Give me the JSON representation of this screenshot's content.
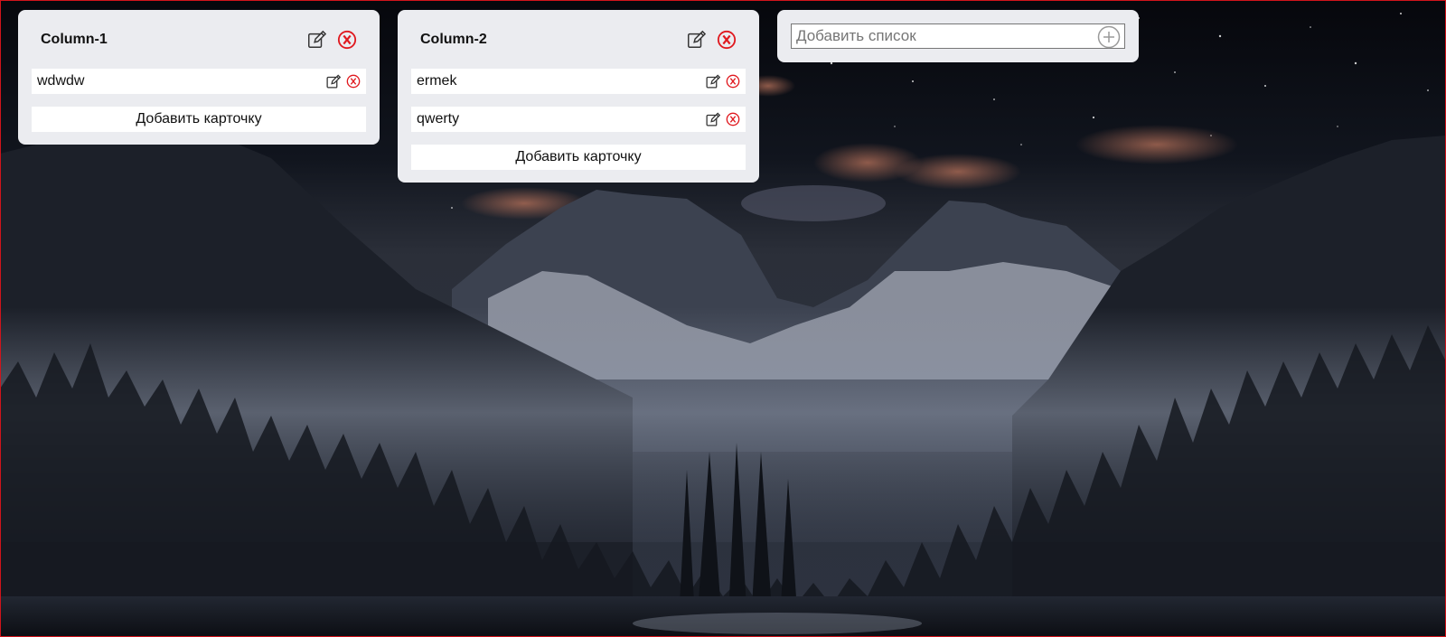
{
  "board": {
    "columns": [
      {
        "title": "Column-1",
        "cards": [
          {
            "text": "wdwdw"
          }
        ],
        "add_card_label": "Добавить карточку"
      },
      {
        "title": "Column-2",
        "cards": [
          {
            "text": "ermek"
          },
          {
            "text": "qwerty"
          }
        ],
        "add_card_label": "Добавить карточку"
      }
    ],
    "add_list": {
      "placeholder": "Добавить список",
      "value": ""
    }
  },
  "icons": {
    "edit": "edit-icon",
    "delete": "close-circle-icon",
    "add": "plus-circle-icon"
  },
  "colors": {
    "panel": "#ebecf0",
    "card": "#ffffff",
    "delete_red": "#e0191f",
    "frame_red": "#d0141b"
  }
}
